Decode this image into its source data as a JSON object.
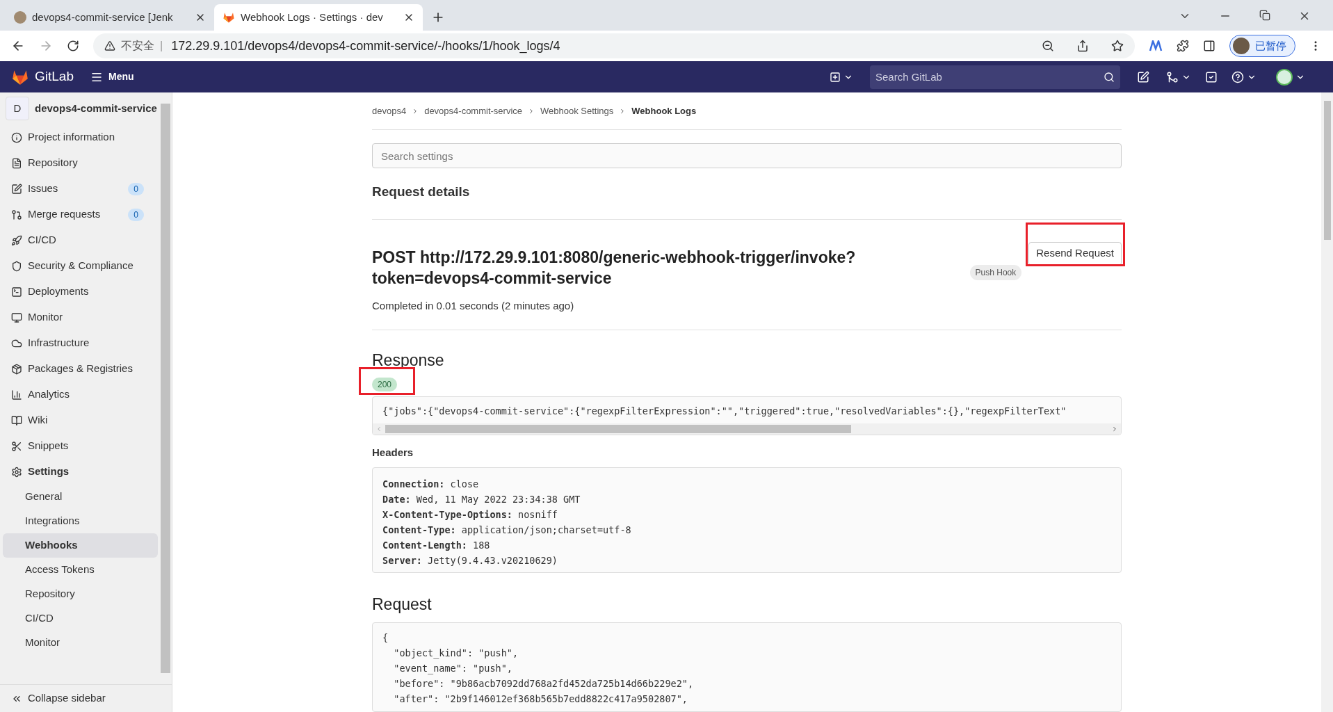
{
  "browser": {
    "tabs": [
      {
        "title": "devops4-commit-service [Jenk",
        "selected": false
      },
      {
        "title": "Webhook Logs · Settings · dev",
        "selected": true
      }
    ],
    "security": "不安全",
    "separator": "|",
    "url": "172.29.9.101/devops4/devops4-commit-service/-/hooks/1/hook_logs/4",
    "profile": "已暂停"
  },
  "topbar": {
    "brand": "GitLab",
    "menu": "Menu",
    "search": {
      "placeholder": "Search GitLab"
    }
  },
  "sidebar": {
    "project_initial": "D",
    "project": "devops4-commit-service",
    "items": [
      {
        "label": "Project information",
        "selected": false
      },
      {
        "label": "Repository",
        "selected": false
      },
      {
        "label": "Issues",
        "count": "0",
        "selected": false
      },
      {
        "label": "Merge requests",
        "count": "0",
        "selected": false
      },
      {
        "label": "CI/CD",
        "selected": false
      },
      {
        "label": "Security & Compliance",
        "selected": false
      },
      {
        "label": "Deployments",
        "selected": false
      },
      {
        "label": "Monitor",
        "selected": false
      },
      {
        "label": "Infrastructure",
        "selected": false
      },
      {
        "label": "Packages & Registries",
        "selected": false
      },
      {
        "label": "Analytics",
        "selected": false
      },
      {
        "label": "Wiki",
        "selected": false
      },
      {
        "label": "Snippets",
        "selected": false
      },
      {
        "label": "Settings",
        "selected": true,
        "children": [
          {
            "label": "General",
            "selected": false
          },
          {
            "label": "Integrations",
            "selected": false
          },
          {
            "label": "Webhooks",
            "selected": true
          },
          {
            "label": "Access Tokens",
            "selected": false
          },
          {
            "label": "Repository",
            "selected": false
          },
          {
            "label": "CI/CD",
            "selected": false
          },
          {
            "label": "Monitor",
            "selected": false
          }
        ]
      }
    ],
    "collapse": "Collapse sidebar"
  },
  "breadcrumbs": [
    {
      "label": "devops4",
      "selected": false
    },
    {
      "label": "devops4-commit-service",
      "selected": false
    },
    {
      "label": "Webhook Settings",
      "selected": false
    },
    {
      "label": "Webhook Logs",
      "selected": true
    }
  ],
  "search_settings": {
    "placeholder": "Search settings"
  },
  "section_title": "Request details",
  "request_title": [
    "POST http://172.29.9.101:8080/generic-webhook-trigger/invoke?",
    "token=devops4-commit-service"
  ],
  "hook_type": "Push Hook",
  "resend": {
    "label": "Resend Request",
    "highlighted": true
  },
  "completed": "Completed in 0.01 seconds (2 minutes ago)",
  "response": {
    "title": "Response",
    "status": {
      "code": "200",
      "highlighted": true
    },
    "body": "{\"jobs\":{\"devops4-commit-service\":{\"regexpFilterExpression\":\"\",\"triggered\":true,\"resolvedVariables\":{},\"regexpFilterText\"",
    "headers_title": "Headers",
    "headers": [
      {
        "name": "Connection:",
        "value": "close"
      },
      {
        "name": "Date:",
        "value": "Wed, 11 May 2022 23:34:38 GMT"
      },
      {
        "name": "X-Content-Type-Options:",
        "value": "nosniff"
      },
      {
        "name": "Content-Type:",
        "value": "application/json;charset=utf-8"
      },
      {
        "name": "Content-Length:",
        "value": "188"
      },
      {
        "name": "Server:",
        "value": "Jetty(9.4.43.v20210629)"
      }
    ]
  },
  "request": {
    "title": "Request",
    "lines": [
      "{",
      "  \"object_kind\": \"push\",",
      "  \"event_name\": \"push\",",
      "  \"before\": \"9b86acb7092dd768a2fd452da725b14d66b229e2\",",
      "  \"after\": \"2b9f146012ef368b565b7edd8822c417a9502807\","
    ]
  }
}
